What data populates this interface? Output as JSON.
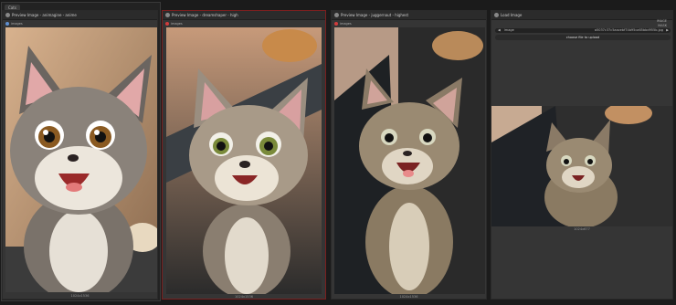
{
  "group": {
    "label": "Cats"
  },
  "nodes": [
    {
      "title": "Preview Image - animagine - anime",
      "output_label": "images",
      "caption": "1024x1536"
    },
    {
      "title": "Preview Image - dreamshaper - high",
      "output_label": "images",
      "caption": "1024x1536"
    },
    {
      "title": "Preview Image - juggernaut - highest",
      "output_label": "images",
      "caption": "1024x1536"
    },
    {
      "title": "Load Image",
      "output_label_1": "IMAGE",
      "output_label_2": "MASK",
      "filename_label": "image",
      "filename": "a5037c37c5aacebf74b95ca65bbd955b.jpg",
      "upload_label": "choose file to upload",
      "caption": "1024x677"
    }
  ],
  "colors": {
    "background": "#1b1b1b",
    "node": "#353535",
    "active_border": "#7a1f1f"
  }
}
